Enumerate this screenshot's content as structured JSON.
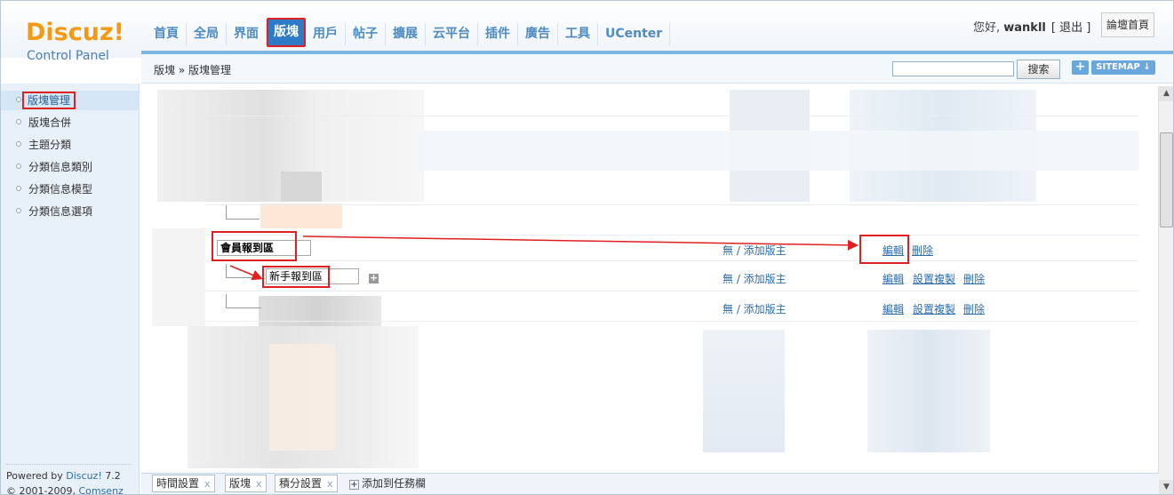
{
  "brand": {
    "logo": "Discuz!",
    "subtitle": "Control Panel"
  },
  "nav": {
    "items": [
      "首頁",
      "全局",
      "界面",
      "版塊",
      "用戶",
      "帖子",
      "擴展",
      "云平台",
      "插件",
      "廣告",
      "工具",
      "UCenter"
    ],
    "active": "版塊"
  },
  "user": {
    "greeting_prefix": "您好, ",
    "name": "wankll",
    "logout": "[ 退出 ]",
    "home_button": "論壇首頁"
  },
  "breadcrumb": "版塊 » 版塊管理",
  "search": {
    "button": "搜索",
    "value": ""
  },
  "toolbar": {
    "plus": "+",
    "sitemap": "SITEMAP ↓"
  },
  "sidebar": {
    "items": [
      "版塊管理",
      "版塊合併",
      "主題分類",
      "分類信息類別",
      "分類信息模型",
      "分類信息選項"
    ],
    "active_index": 0
  },
  "powered": {
    "line1_prefix": "Powered by ",
    "line1_link": "Discuz!",
    "line1_suffix": " 7.2",
    "line2_prefix": "© 2001-2009, ",
    "line2_link": "Comsenz Inc."
  },
  "forums": {
    "group_name": "會員報到區",
    "sub_name": "新手報到區",
    "moderator_text": "無 / 添加版主",
    "actions": {
      "edit": "編輯",
      "delete": "刪除",
      "copy": "設置複製"
    },
    "expand": "+"
  },
  "taskbar": {
    "tabs": [
      "時間設置",
      "版塊",
      "積分設置"
    ],
    "close": "x",
    "add": "添加到任務欄"
  }
}
